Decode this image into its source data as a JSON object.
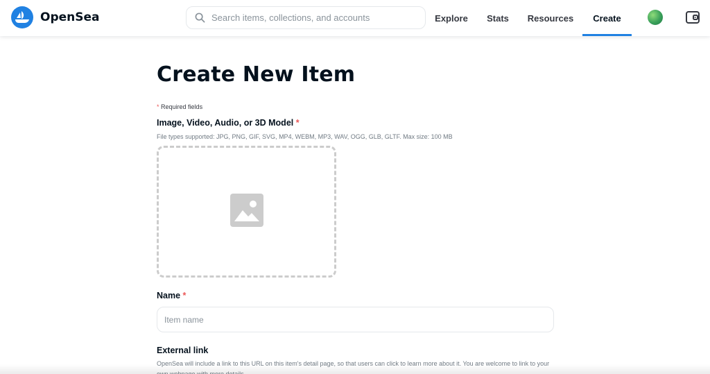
{
  "header": {
    "brand": "OpenSea",
    "search": {
      "placeholder": "Search items, collections, and accounts",
      "value": ""
    },
    "nav": [
      "Explore",
      "Stats",
      "Resources",
      "Create"
    ],
    "active_nav": "Create",
    "accent_color": "#2081e2"
  },
  "main": {
    "title": "Create New Item",
    "required_note": "Required fields",
    "required_marker": "*",
    "media": {
      "label": "Image, Video, Audio, or 3D Model",
      "description": "File types supported: JPG, PNG, GIF, SVG, MP4, WEBM, MP3, WAV, OGG, GLB, GLTF. Max size: 100 MB",
      "icon": "image-placeholder-icon"
    },
    "name": {
      "label": "Name",
      "placeholder": "Item name",
      "value": ""
    },
    "external_link": {
      "label": "External link",
      "description": "OpenSea will include a link to this URL on this item's detail page, so that users can click to learn more about it. You are welcome to link to your own webpage with more details."
    }
  },
  "colors": {
    "required": "#eb5757",
    "text": "#04111d",
    "muted": "#707a83"
  }
}
